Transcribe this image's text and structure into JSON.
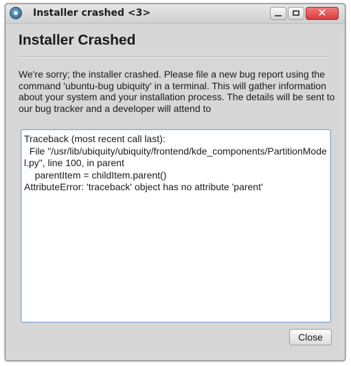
{
  "window": {
    "title": "Installer crashed <3>",
    "app_icon": "ubiquity-installer-icon",
    "controls": {
      "minimize_icon": "minimize-icon",
      "maximize_icon": "maximize-icon",
      "close_glyph": "✕"
    }
  },
  "dialog": {
    "heading": "Installer Crashed",
    "message": "We're sorry; the installer crashed. Please file a new bug report using the command 'ubuntu-bug ubiquity' in a terminal. This will gather information about your system and your installation process. The details will be sent to our bug tracker and a developer will attend to",
    "traceback": "Traceback (most recent call last):\n  File \"/usr/lib/ubiquity/ubiquity/frontend/kde_components/PartitionModel.py\", line 100, in parent\n    parentItem = childItem.parent()\nAttributeError: 'traceback' object has no attribute 'parent'",
    "close_label": "Close"
  },
  "colors": {
    "window_bg": "#d7d7d7",
    "close_button_red": "#d93b3b",
    "textarea_focus": "#7fa6cf"
  }
}
